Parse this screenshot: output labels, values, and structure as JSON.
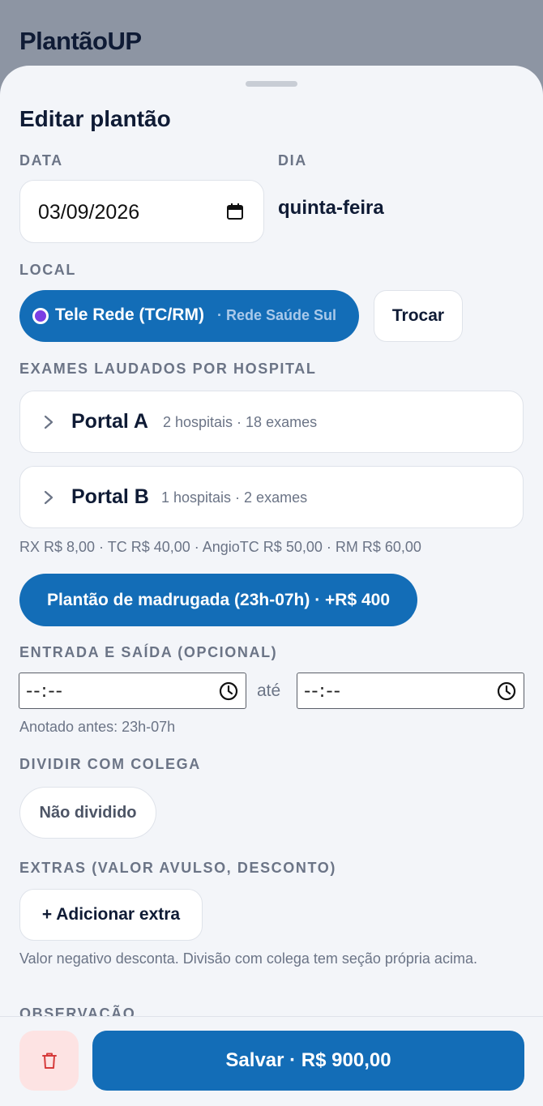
{
  "app": {
    "title": "PlantãoUP"
  },
  "sheet": {
    "title": "Editar plantão",
    "date_label": "DATA",
    "date_value": "03/09/2026",
    "day_label": "DIA",
    "day_value": "quinta-feira",
    "local_label": "LOCAL",
    "local_name": "Tele Rede (TC/RM)",
    "local_sub": "· Rede Saúde Sul",
    "local_dot_color": "#7b3fe4",
    "swap_label": "Trocar",
    "exams_label": "EXAMES LAUDADOS POR HOSPITAL",
    "portals": [
      {
        "name": "Portal A",
        "meta": "2 hospitais · 18 exames"
      },
      {
        "name": "Portal B",
        "meta": "1 hospitais · 2 exames"
      }
    ],
    "prices": "RX R$ 8,00 · TC R$ 40,00 · AngioTC R$ 50,00 · RM R$ 60,00",
    "night_shift": "Plantão de madrugada (23h-07h) · +R$ 400",
    "entry_label": "ENTRADA E SAÍDA (OPCIONAL)",
    "time_start": "--:--",
    "time_sep": "até",
    "time_end": "--:--",
    "noted_before": "Anotado antes: 23h-07h",
    "split_label": "DIVIDIR COM COLEGA",
    "split_value": "Não dividido",
    "extras_label": "EXTRAS (VALOR AVULSO, DESCONTO)",
    "add_extra": "+ Adicionar extra",
    "extras_hint": "Valor negativo desconta. Divisão com colega tem seção própria acima.",
    "notes_label": "OBSERVAÇÃO"
  },
  "footer": {
    "save_label": "Salvar · R$ 900,00",
    "delete_icon": "trash-icon"
  },
  "colors": {
    "primary": "#136db7",
    "danger_bg": "#fde3e3",
    "danger": "#d63b3b",
    "text_muted": "#6b7486",
    "text_dark": "#0f1b35"
  }
}
